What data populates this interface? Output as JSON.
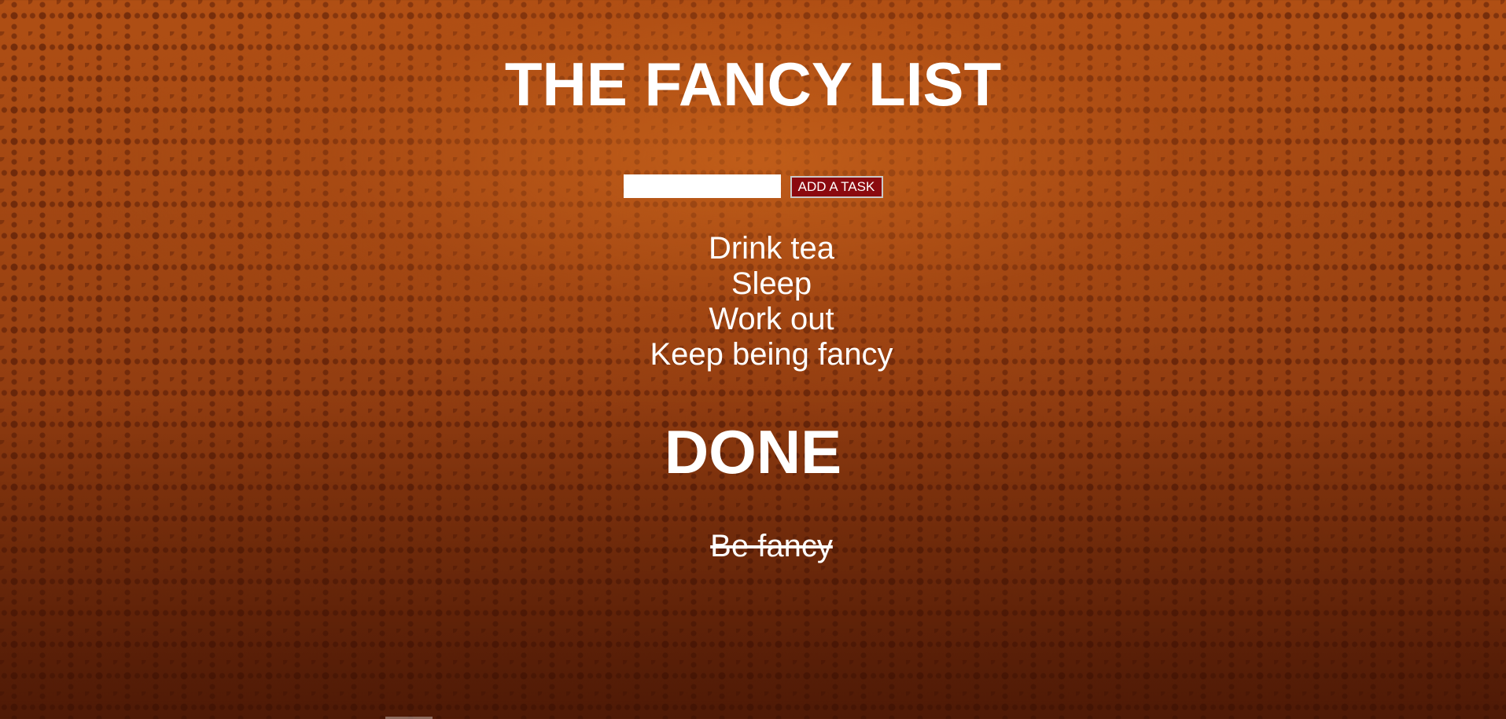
{
  "app": {
    "title": "THE FANCY LIST"
  },
  "add_task": {
    "input_value": "",
    "input_placeholder": "",
    "button_label": "ADD A TASK"
  },
  "todo": {
    "items": [
      {
        "label": "Drink tea"
      },
      {
        "label": "Sleep"
      },
      {
        "label": "Work out"
      },
      {
        "label": "Keep being fancy"
      }
    ]
  },
  "done": {
    "title": "DONE",
    "items": [
      {
        "label": "Be fancy"
      }
    ]
  },
  "colors": {
    "background": "#9a4212",
    "text": "#ffffff",
    "button_bg": "#8b0a0f",
    "button_border": "#c9c9c9"
  }
}
